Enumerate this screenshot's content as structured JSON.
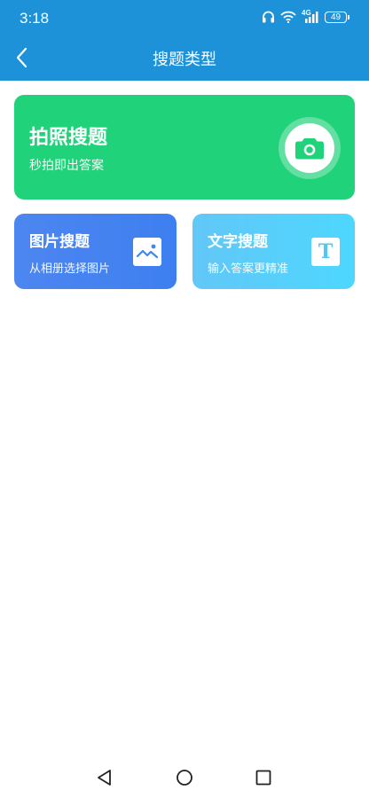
{
  "status_bar": {
    "time": "3:18",
    "battery": "49",
    "network": "4G"
  },
  "nav": {
    "title": "搜题类型",
    "back_icon": "chevron-left-icon"
  },
  "cards": {
    "photo": {
      "title": "拍照搜题",
      "subtitle": "秒拍即出答案",
      "icon": "camera-icon",
      "color": "#20d27a"
    },
    "image": {
      "title": "图片搜题",
      "subtitle": "从相册选择图片",
      "icon": "image-icon",
      "color": "#4585f0"
    },
    "text": {
      "title": "文字搜题",
      "subtitle": "输入答案更精准",
      "icon": "text-icon",
      "glyph": "T",
      "color": "#55cffa"
    }
  },
  "system_nav": {
    "back": "triangle-back-icon",
    "home": "circle-home-icon",
    "recents": "square-recents-icon"
  },
  "colors": {
    "header": "#1d92d9",
    "background": "#ffffff"
  }
}
